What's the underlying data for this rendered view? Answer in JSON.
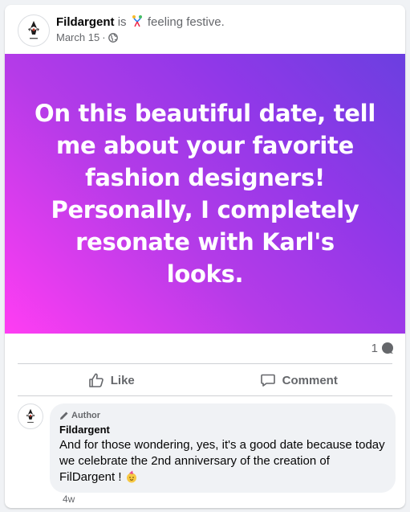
{
  "post": {
    "author": "Fildargent",
    "is_text": "is",
    "feeling_text": "feeling festive.",
    "date": "March 15",
    "separator": "·",
    "banner_text": "On this beautiful date, tell me about your favorite fashion designers! Personally, I completely resonate with Karl's looks.",
    "banner_colors": [
      "#ff3df3",
      "#b53be8",
      "#6b3fe0"
    ]
  },
  "stats": {
    "comment_count": "1"
  },
  "actions": {
    "like_label": "Like",
    "comment_label": "Comment"
  },
  "comment": {
    "badge": "Author",
    "name": "Fildargent",
    "text": "And for those wondering, yes, it's a good date because today we celebrate the 2nd anniversary of the creation of FilDargent !",
    "emoji": "face-with-party-hat",
    "age": "4w"
  },
  "icons": [
    "feeling-icon",
    "globe-icon",
    "comment-bubble-icon",
    "like-icon",
    "comment-icon",
    "pencil-icon",
    "party-emoji-icon",
    "avatar-logo-icon"
  ]
}
